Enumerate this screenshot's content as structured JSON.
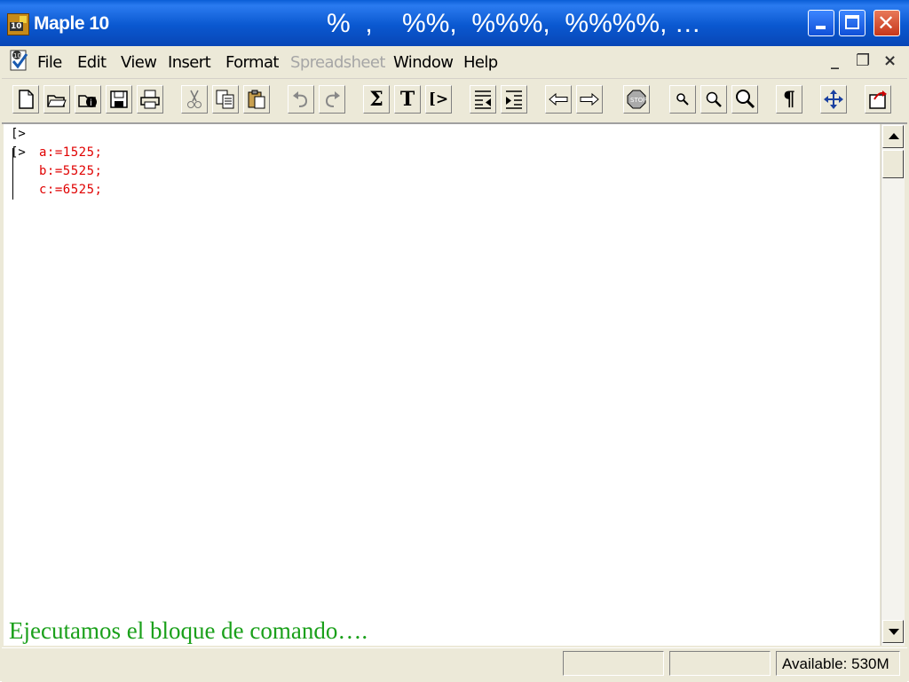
{
  "window": {
    "title": "Maple 10",
    "overlay_title": "%  ,    %%,  %%%,  %%%%, …",
    "icon_label": "10"
  },
  "menubar": {
    "items": [
      {
        "label": "File",
        "enabled": true
      },
      {
        "label": "Edit",
        "enabled": true
      },
      {
        "label": "View",
        "enabled": true
      },
      {
        "label": "Insert",
        "enabled": true
      },
      {
        "label": "Format",
        "enabled": true
      },
      {
        "label": "Spreadsheet",
        "enabled": false
      },
      {
        "label": "Window",
        "enabled": true
      },
      {
        "label": "Help",
        "enabled": true
      }
    ],
    "mdi_minimize": "_",
    "mdi_restore": "❐",
    "mdi_close": "×"
  },
  "toolbar": {
    "icons": [
      "new-document-icon",
      "open-folder-icon",
      "open-url-icon",
      "save-icon",
      "print-icon",
      "cut-icon",
      "copy-icon",
      "paste-icon",
      "undo-icon",
      "redo-icon",
      "sum-icon",
      "text-icon",
      "prompt-icon",
      "outdent-icon",
      "indent-icon",
      "back-icon",
      "forward-icon",
      "stop-icon",
      "zoom-small-icon",
      "zoom-medium-icon",
      "zoom-large-icon",
      "pilcrow-icon",
      "move-icon",
      "restart-icon"
    ],
    "sum_glyph": "Σ",
    "text_glyph": "T",
    "prompt_glyph": "[>",
    "pilcrow_glyph": "¶"
  },
  "document": {
    "prompt_symbol": "[>",
    "group_prompt": "[>",
    "lines": [
      "a:=1525;",
      "b:=5525;",
      "c:=6525;"
    ],
    "code_color": "#e00000",
    "caption": "Ejecutamos el bloque de comando….",
    "caption_color": "#1aa01a"
  },
  "statusbar": {
    "available": "Available: 530M"
  }
}
